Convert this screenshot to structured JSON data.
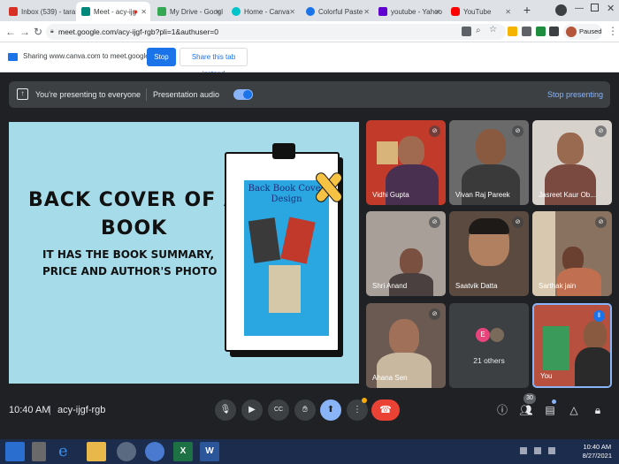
{
  "browser": {
    "tabs": [
      {
        "label": "Inbox (539) - tara",
        "color": "#d93025"
      },
      {
        "label": "Meet - acy-ijg",
        "color": "#00897b"
      },
      {
        "label": "My Drive - Googl",
        "color": "#34a853"
      },
      {
        "label": "Home - Canva",
        "color": "#00c4cc"
      },
      {
        "label": "Colorful Paste",
        "color": "#1a73e8"
      },
      {
        "label": "youtube - Yahoo",
        "color": "#6001d2"
      },
      {
        "label": "YouTube",
        "color": "#ff0000"
      }
    ],
    "new_tab": "+",
    "url": "meet.google.com/acy-ijgf-rgb?pli=1&authuser=0",
    "profile_status": "Paused"
  },
  "sharing_bar": {
    "text": "Sharing www.canva.com to meet.google.com",
    "stop_label": "Stop",
    "share_tab_label": "Share this tab instead"
  },
  "presentation_bar": {
    "presenting_text": "You're presenting to everyone",
    "audio_label": "Presentation audio",
    "stop_label": "Stop presenting"
  },
  "slide": {
    "line1": "Back cover of  a",
    "line2": "book",
    "line3": "It has the book summary,",
    "line4": "price and author's photo",
    "book_title": "Back Book Cover Design"
  },
  "participants": [
    {
      "name": "Vidhi Gupta",
      "bg": "#c23a2a"
    },
    {
      "name": "Vivan Raj Pareek",
      "bg": "#6a6a6a"
    },
    {
      "name": "Jasreet Kaur Ob...",
      "bg": "#d8d2cc"
    },
    {
      "name": "Shri Anand",
      "bg": "#a8a098"
    },
    {
      "name": "Saatvik Datta",
      "bg": "#5a4a40"
    },
    {
      "name": "Sarthak jain",
      "bg": "#8a7260"
    },
    {
      "name": "Ahana Sen",
      "bg": "#6a5a52"
    },
    {
      "name": "21 others",
      "bg": "#3c4043"
    },
    {
      "name": "You",
      "bg": "#b85040"
    }
  ],
  "others_avatar_letter": "E",
  "controls": {
    "time": "10:40 AM",
    "separator": "|",
    "meeting_code": "acy-ijgf-rgb",
    "participant_count": "30"
  },
  "taskbar": {
    "time": "10:40 AM",
    "date": "8/27/2021"
  }
}
